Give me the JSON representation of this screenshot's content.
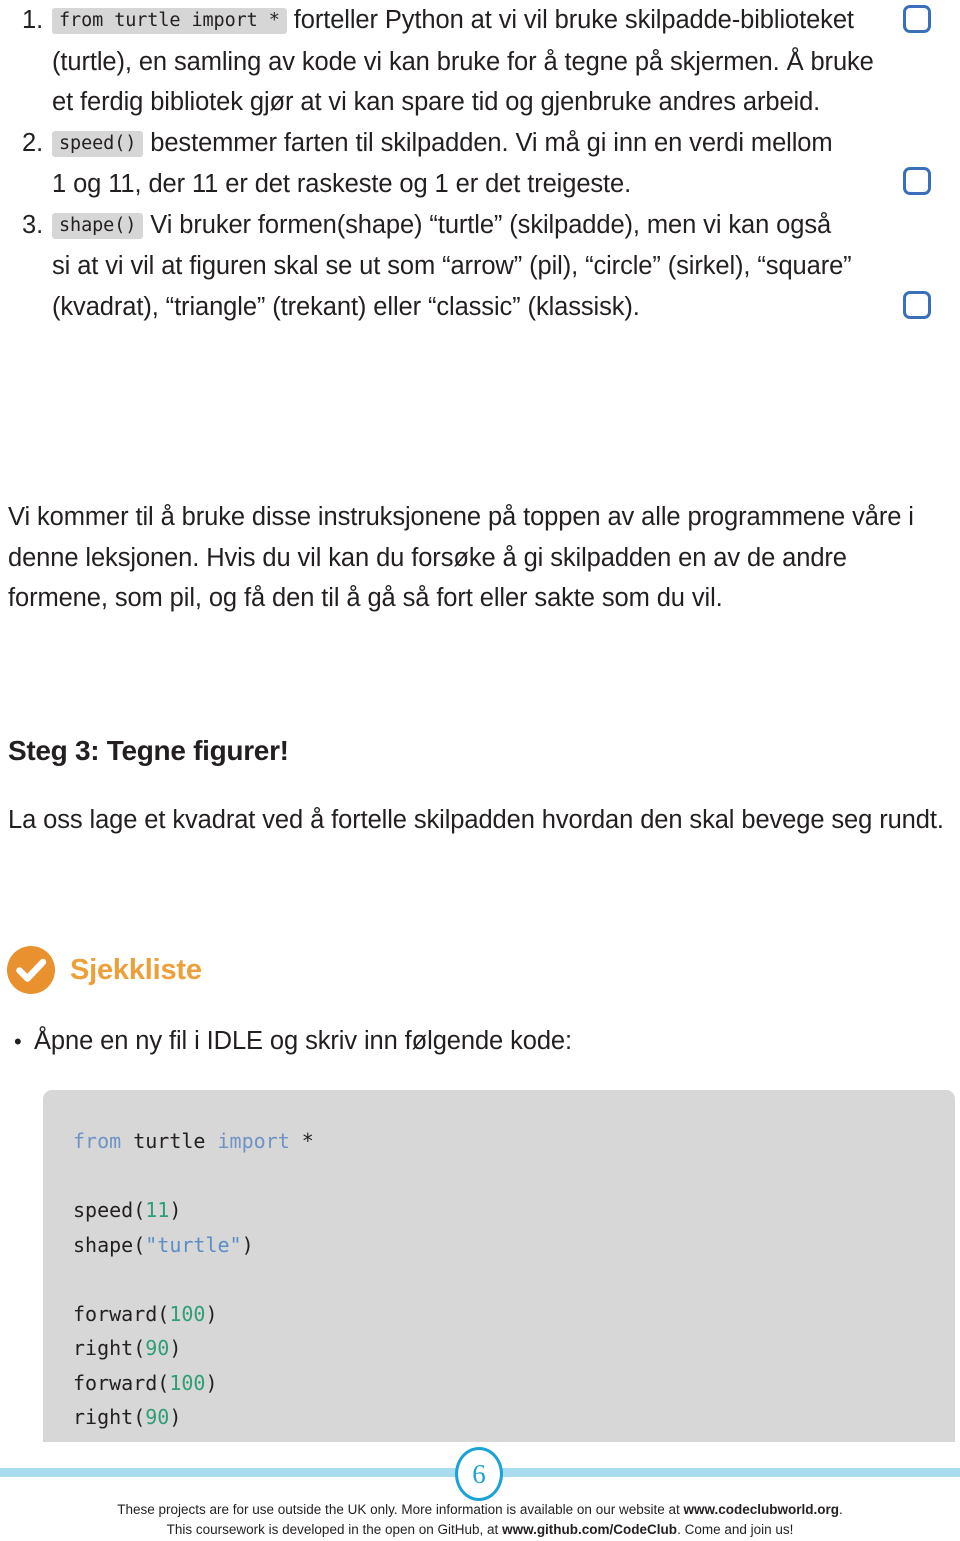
{
  "document": {
    "list": {
      "items": [
        {
          "marker": "1.",
          "code_chip": "from turtle import *",
          "text": " forteller Python at vi vil bruke skilpadde-biblioteket (turtle), en samling av kode vi kan bruke for å tegne på skjermen. Å bruke et ferdig bibliotek gjør at vi kan spare tid og gjenbruke andres arbeid.",
          "checkbox": "unchecked"
        },
        {
          "marker": "2.",
          "code_chip": "speed()",
          "text": " bestemmer farten til skilpadden. Vi må gi inn en verdi mellom 1 og 11, der 11 er det raskeste og 1 er det treigeste.",
          "checkbox": "unchecked"
        },
        {
          "marker": "3.",
          "code_chip": "shape()",
          "text": " Vi bruker formen(shape) “turtle” (skilpadde), men vi kan også si at vi vil at figuren skal se ut som “arrow” (pil), “circle” (sirkel), “square” (kvadrat), “triangle” (trekant) eller “classic” (klassisk).",
          "checkbox": "unchecked"
        }
      ]
    },
    "intro_paragraph": "Vi kommer til å bruke disse instruksjonene på toppen av alle programmene våre i denne leksjonen. Hvis du vil kan du forsøke å gi skilpadden en av de andre formene, som pil, og få den til å gå så fort eller sakte som du vil.",
    "step_heading": "Steg 3: Tegne figurer!",
    "square_paragraph": "La oss lage et kvadrat ved å fortelle skilpadden hvordan den skal bevege seg rundt.",
    "checklist": {
      "icon": "check-circle-icon",
      "title": "Sjekkliste",
      "accent_color": "#eda03a",
      "bullet": {
        "marker": "•",
        "text": "Åpne en ny fil i IDLE og skriv inn følgende kode:"
      }
    },
    "code_block": {
      "language": "python",
      "background_color": "#d7d7d7",
      "lines": [
        [
          {
            "t": "from",
            "c": "kw"
          },
          {
            "t": " turtle ",
            "c": "plain"
          },
          {
            "t": "import",
            "c": "kw"
          },
          {
            "t": " *",
            "c": "plain"
          }
        ],
        [],
        [
          {
            "t": "speed(",
            "c": "plain"
          },
          {
            "t": "11",
            "c": "num"
          },
          {
            "t": ")",
            "c": "plain"
          }
        ],
        [
          {
            "t": "shape(",
            "c": "plain"
          },
          {
            "t": "\"turtle\"",
            "c": "str"
          },
          {
            "t": ")",
            "c": "plain"
          }
        ],
        [],
        [
          {
            "t": "forward(",
            "c": "plain"
          },
          {
            "t": "100",
            "c": "num"
          },
          {
            "t": ")",
            "c": "plain"
          }
        ],
        [
          {
            "t": "right(",
            "c": "plain"
          },
          {
            "t": "90",
            "c": "num"
          },
          {
            "t": ")",
            "c": "plain"
          }
        ],
        [
          {
            "t": "forward(",
            "c": "plain"
          },
          {
            "t": "100",
            "c": "num"
          },
          {
            "t": ")",
            "c": "plain"
          }
        ],
        [
          {
            "t": "right(",
            "c": "plain"
          },
          {
            "t": "90",
            "c": "num"
          },
          {
            "t": ")",
            "c": "plain"
          }
        ]
      ]
    },
    "footer": {
      "page_number": "6",
      "rule_color": "#aadcef",
      "badge_color": "#1aa3d4",
      "line1_before": "These projects are for use outside the UK only. More information is available on our website at ",
      "line1_bold": "www.codeclubworld.org",
      "line1_after": ".",
      "line2_before": "This coursework is developed in the open on GitHub, at ",
      "line2_bold": "www.github.com/CodeClub",
      "line2_after": ". Come and join us!"
    }
  }
}
